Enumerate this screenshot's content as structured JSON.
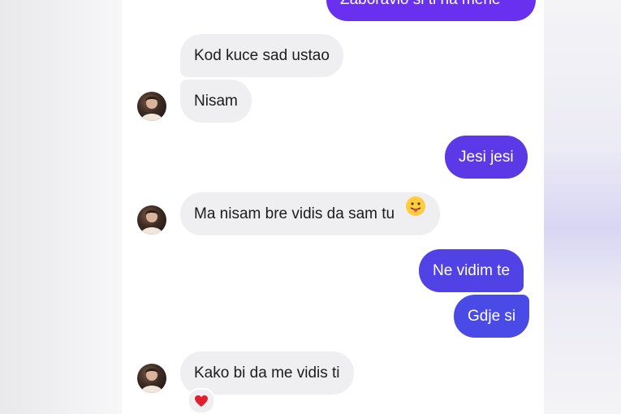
{
  "conversation": {
    "messages": [
      {
        "id": "m1",
        "direction": "outgoing",
        "text": "Zaboravio si ti na mene"
      },
      {
        "id": "m2",
        "direction": "incoming",
        "text": "Kod kuce sad ustao"
      },
      {
        "id": "m3",
        "direction": "incoming",
        "text": "Nisam"
      },
      {
        "id": "m4",
        "direction": "outgoing",
        "text": "Jesi jesi"
      },
      {
        "id": "m5",
        "direction": "incoming",
        "text": "Ma nisam bre vidis da sam tu",
        "emoji": "face-with-tongue-icon"
      },
      {
        "id": "m6",
        "direction": "outgoing",
        "text": "Ne vidim te"
      },
      {
        "id": "m7",
        "direction": "outgoing",
        "text": "Gdje si"
      },
      {
        "id": "m8",
        "direction": "incoming",
        "text": "Kako bi da me vidis ti",
        "reaction": "red-heart-icon"
      }
    ]
  },
  "colors": {
    "outgoing_top": "#6c2ff0",
    "outgoing_bottom": "#4a4be6",
    "incoming_bubble": "#efeff1",
    "incoming_text": "#1c1c1e",
    "outgoing_text": "#ffffff"
  }
}
